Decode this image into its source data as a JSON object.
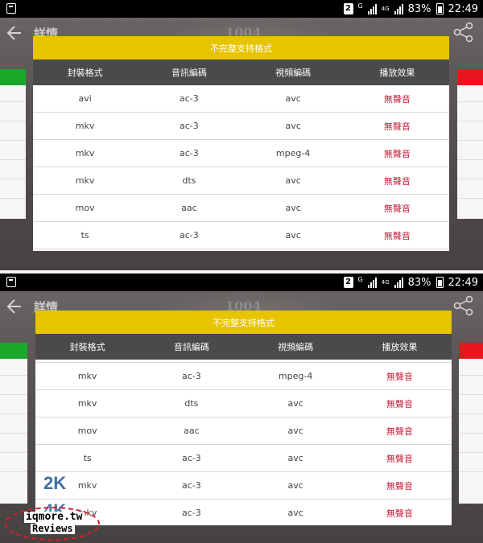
{
  "status_bar": {
    "sim_badge": "2",
    "network_small": "G",
    "network_4g": "4G",
    "battery_pct": "83%",
    "time": "22:49"
  },
  "header": {
    "title": "詳情",
    "number": "1004"
  },
  "colors": {
    "title_bar": "#e7c400",
    "header_bar": "#4a4a4a",
    "effect_text": "#c8203c",
    "left_card_accent": "#1aa82a",
    "right_card_accent": "#e8151e"
  },
  "dialog": {
    "title": "不完整支持格式",
    "columns": [
      "封裝格式",
      "音訊編碼",
      "視頻編碼",
      "播放效果"
    ],
    "rows_top": [
      [
        "avi",
        "ac-3",
        "avc",
        "無聲音"
      ],
      [
        "mkv",
        "ac-3",
        "avc",
        "無聲音"
      ],
      [
        "mkv",
        "ac-3",
        "mpeg-4",
        "無聲音"
      ],
      [
        "mkv",
        "dts",
        "avc",
        "無聲音"
      ],
      [
        "mov",
        "aac",
        "avc",
        "無聲音"
      ],
      [
        "ts",
        "ac-3",
        "avc",
        "無聲音"
      ]
    ],
    "rows_bottom": [
      [
        "mkv",
        "ac-3",
        "mpeg-4",
        "無聲音"
      ],
      [
        "mkv",
        "dts",
        "avc",
        "無聲音"
      ],
      [
        "mov",
        "aac",
        "avc",
        "無聲音"
      ],
      [
        "ts",
        "ac-3",
        "avc",
        "無聲音"
      ],
      [
        "mkv",
        "ac-3",
        "avc",
        "無聲音"
      ],
      [
        "mkv",
        "ac-3",
        "avc",
        "無聲音"
      ]
    ]
  },
  "watermark": {
    "badge_2k": "2K",
    "badge_4k": "4K",
    "logo_line1": "iqmore.tw",
    "logo_line2": "Reviews"
  }
}
